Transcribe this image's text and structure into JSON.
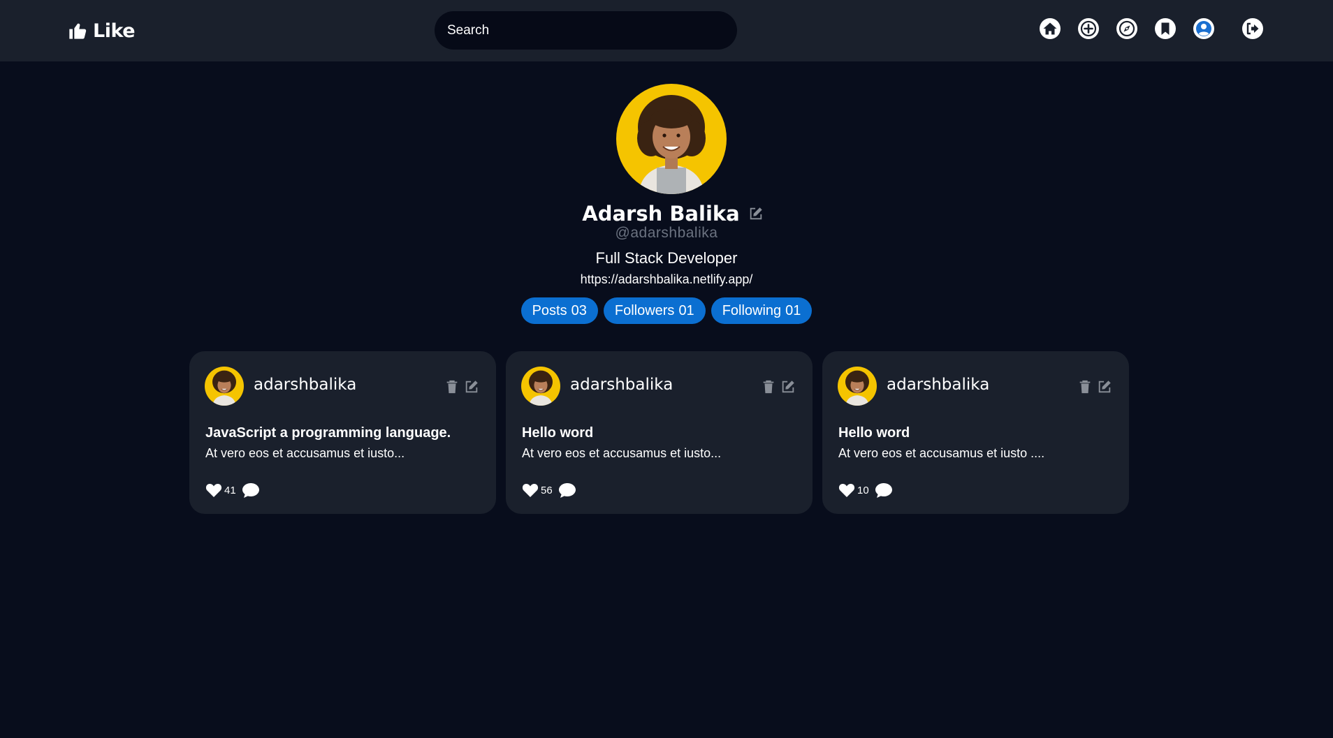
{
  "nav": {
    "brand": "Like",
    "search_placeholder": "Search",
    "icons": [
      "home-icon",
      "add-post-icon",
      "explore-icon",
      "bookmark-icon",
      "profile-icon",
      "logout-icon"
    ]
  },
  "profile": {
    "name": "Adarsh Balika",
    "handle": "@adarshbalika",
    "bio": "Full Stack Developer",
    "website": "https://adarshbalika.netlify.app/",
    "stats": [
      {
        "label": "Posts",
        "value": "03"
      },
      {
        "label": "Followers",
        "value": "01"
      },
      {
        "label": "Following",
        "value": "01"
      }
    ]
  },
  "posts": [
    {
      "username": "adarshbalika",
      "title": "JavaScript a programming language.",
      "excerpt": "At vero eos et accusamus et iusto...",
      "likes": "41"
    },
    {
      "username": "adarshbalika",
      "title": "Hello word",
      "excerpt": "At vero eos et accusamus et iusto...",
      "likes": "56"
    },
    {
      "username": "adarshbalika",
      "title": "Hello word",
      "excerpt": "At vero eos et accusamus et iusto ....",
      "likes": "10"
    }
  ],
  "colors": {
    "page_bg": "#080d1c",
    "navbar_bg": "#1a202c",
    "card_bg": "#1a202c",
    "accent": "#0b6fd1",
    "avatar_bg": "#f5c400"
  }
}
